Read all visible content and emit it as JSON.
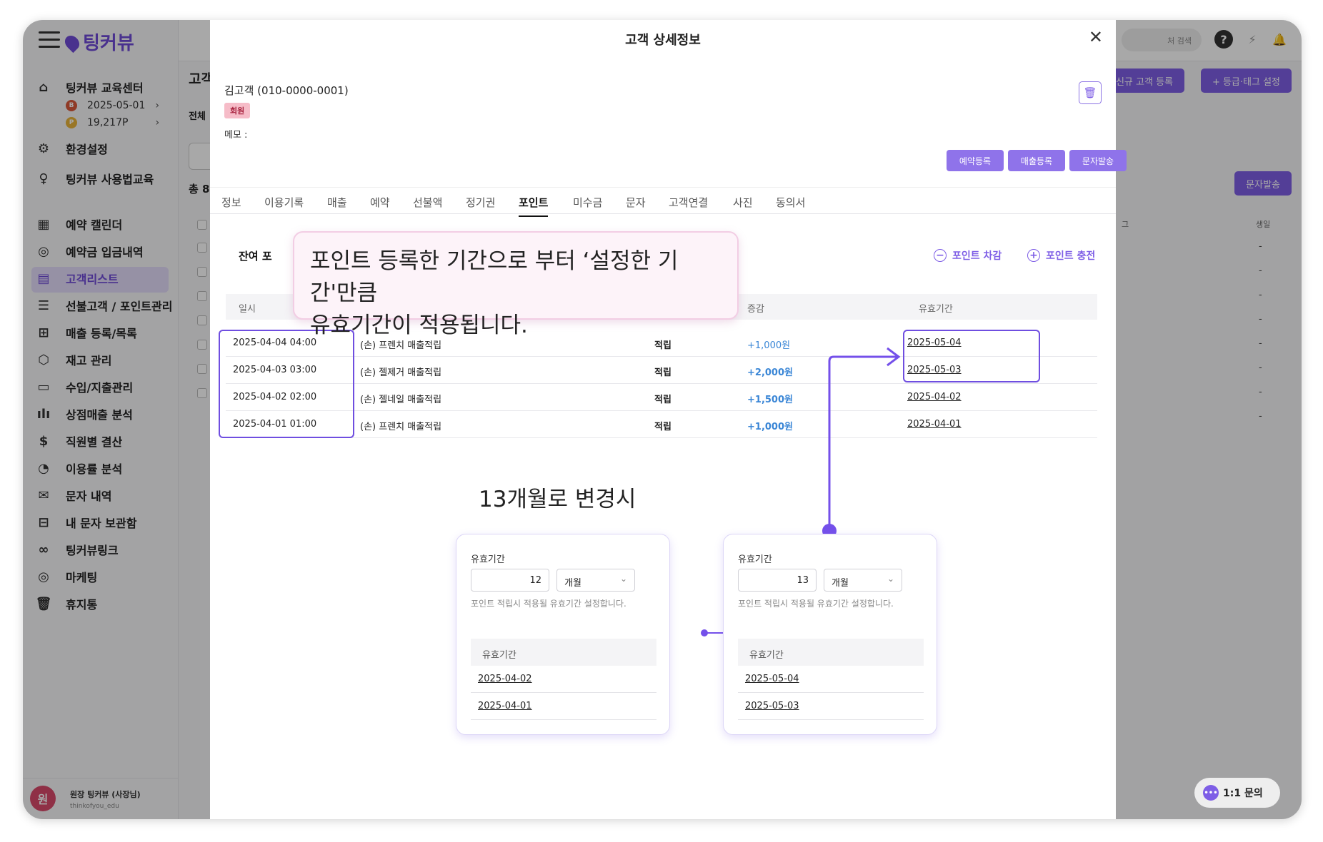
{
  "sidebar": {
    "logo": "팅커뷰",
    "items": [
      {
        "label": "팅커뷰 교육센터",
        "icon": "home-icon"
      },
      {
        "label": "환경설정",
        "icon": "gear-icon"
      },
      {
        "label": "팅커뷰 사용법교육",
        "icon": "lightbulb-icon"
      },
      {
        "label": "예약 캘린더",
        "icon": "calendar-icon"
      },
      {
        "label": "예약금 입금내역",
        "icon": "coin-icon"
      },
      {
        "label": "고객리스트",
        "icon": "document-icon"
      },
      {
        "label": "선불고객 / 포인트관리",
        "icon": "database-icon"
      },
      {
        "label": "매출 등록/목록",
        "icon": "file-plus-icon"
      },
      {
        "label": "재고 관리",
        "icon": "box-icon"
      },
      {
        "label": "수입/지출관리",
        "icon": "card-icon"
      },
      {
        "label": "상점매출 분석",
        "icon": "bar-chart-icon"
      },
      {
        "label": "직원별 결산",
        "icon": "dollar-icon"
      },
      {
        "label": "이용률 분석",
        "icon": "pie-chart-icon"
      },
      {
        "label": "문자 내역",
        "icon": "mail-icon"
      },
      {
        "label": "내 문자 보관함",
        "icon": "archive-icon"
      },
      {
        "label": "팅커뷰링크",
        "icon": "link-icon"
      },
      {
        "label": "마케팅",
        "icon": "target-icon"
      },
      {
        "label": "휴지통",
        "icon": "trash-icon"
      }
    ],
    "date_value": "2025-05-01",
    "points_value": "19,217P",
    "user_name": "원장 팅커뷰 (사장님)",
    "user_id": "thinkofyou_edu",
    "user_initial": "원"
  },
  "background": {
    "title": "고객",
    "tab": "전체",
    "total": "총 8",
    "search_placeholder": "처 검색",
    "btn_new_customer": "신규 고객 등록",
    "btn_grade_tag": "+ 등급·태그 설정",
    "btn_sms": "문자발송",
    "col_tag": "그",
    "col_birthday": "생일",
    "dash": "-",
    "chat_label": "1:1 문의"
  },
  "modal": {
    "title": "고객 상세정보",
    "customer_name": "김고객 (010-0000-0001)",
    "member_badge": "회원",
    "memo_label": "메모 :",
    "buttons": [
      "예약등록",
      "매출등록",
      "문자발송"
    ],
    "tabs": [
      "정보",
      "이용기록",
      "매출",
      "예약",
      "선불액",
      "정기권",
      "포인트",
      "미수금",
      "문자",
      "고객연결",
      "사진",
      "동의서"
    ],
    "active_tab": "포인트",
    "remaining_label": "잔여 포",
    "point_deduct": "포인트 차감",
    "point_charge": "포인트 충전",
    "table": {
      "headers": [
        "일시",
        "증감",
        "유효기간"
      ],
      "rows": [
        {
          "date": "2025-04-04 04:00",
          "desc": "(손) 프렌치 매출적립",
          "kind": "적립",
          "amount": "+1,000원",
          "expiry": "2025-05-04"
        },
        {
          "date": "2025-04-03 03:00",
          "desc": "(손) 젤제거 매출적립",
          "kind": "적립",
          "amount": "+2,000원",
          "expiry": "2025-05-03"
        },
        {
          "date": "2025-04-02 02:00",
          "desc": "(손) 젤네일 매출적립",
          "kind": "적립",
          "amount": "+1,500원",
          "expiry": "2025-04-02"
        },
        {
          "date": "2025-04-01 01:00",
          "desc": "(손) 프렌치 매출적립",
          "kind": "적립",
          "amount": "+1,000원",
          "expiry": "2025-04-01"
        }
      ]
    }
  },
  "tooltip": {
    "line1": "포인트 등록한 기간으로 부터 ‘설정한 기간'만큼",
    "line2": "유효기간이 적용됩니다."
  },
  "annotation": {
    "title": "13개월로 변경시",
    "cards": [
      {
        "label": "유효기간",
        "number": "12",
        "unit": "개월",
        "help": "포인트 적립시 적용될 유효기간 설정합니다.",
        "table_header": "유효기간",
        "rows": [
          "2025-04-02",
          "2025-04-01"
        ]
      },
      {
        "label": "유효기간",
        "number": "13",
        "unit": "개월",
        "help": "포인트 적립시 적용될 유효기간 설정합니다.",
        "table_header": "유효기간",
        "rows": [
          "2025-05-04",
          "2025-05-03"
        ]
      }
    ]
  },
  "colors": {
    "accent": "#7e5ee6",
    "highlight": "#6f4ee0",
    "amount": "#3a86d6",
    "badge": "#f6bcc8"
  }
}
